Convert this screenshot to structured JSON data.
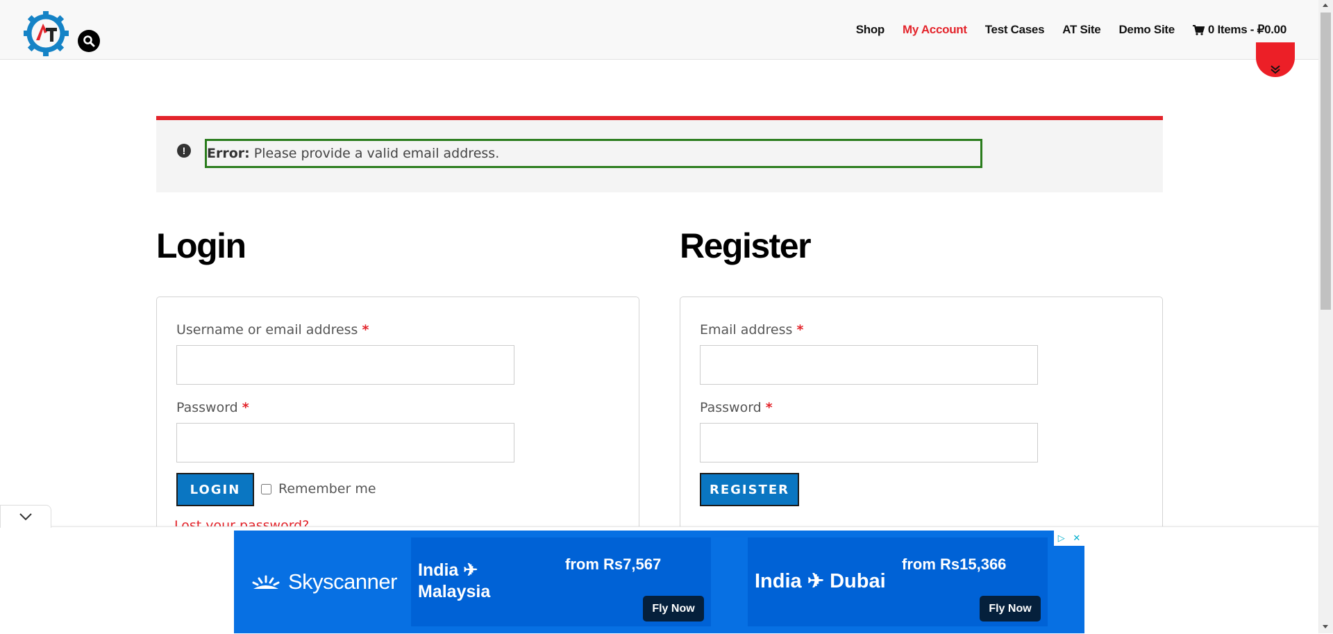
{
  "header": {
    "logo_icon": "gear-logo-icon",
    "search_icon": "search-icon",
    "nav": [
      {
        "label": "Shop",
        "active": false
      },
      {
        "label": "My Account",
        "active": true
      },
      {
        "label": "Test Cases",
        "active": false
      },
      {
        "label": "AT Site",
        "active": false
      },
      {
        "label": "Demo Site",
        "active": false
      }
    ],
    "cart": {
      "icon": "cart-icon",
      "label": "0 Items - ₽0.00"
    },
    "accent_color": "#e3242b"
  },
  "notice": {
    "prefix": "Error:",
    "message": " Please provide a valid email address.",
    "icon": "exclamation-circle-icon"
  },
  "login": {
    "title": "Login",
    "username_label": "Username or email address",
    "username_value": "",
    "password_label": "Password",
    "password_value": "",
    "required": "*",
    "button": "LOGIN",
    "remember_label": "Remember me",
    "lost_password": "Lost your password?"
  },
  "register": {
    "title": "Register",
    "email_label": "Email address",
    "email_value": "",
    "password_label": "Password",
    "password_value": "",
    "required": "*",
    "button": "REGISTER"
  },
  "ad": {
    "brand": "Skyscanner",
    "offers": [
      {
        "from": "India",
        "to": "Malaysia",
        "price": "from Rs7,567",
        "cta": "Fly Now"
      },
      {
        "from": "India",
        "to": "Dubai",
        "price": "from Rs15,366",
        "cta": "Fly Now"
      }
    ],
    "bg_color": "#0770e3"
  }
}
